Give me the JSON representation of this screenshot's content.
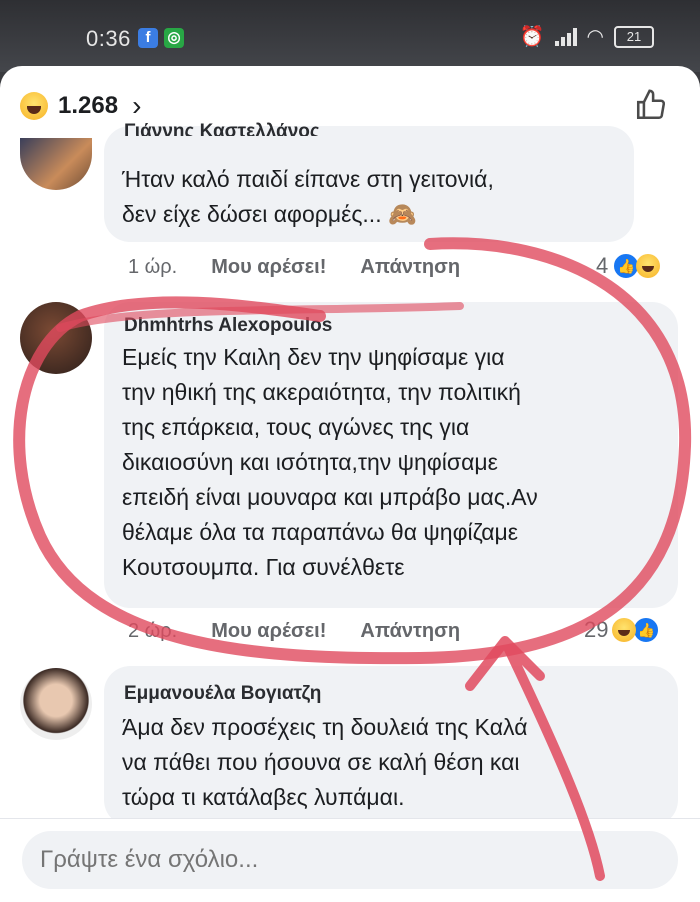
{
  "statusbar": {
    "time": "0:36",
    "battery": "21"
  },
  "header": {
    "reaction_count": "1.268",
    "chevron": "›"
  },
  "comments": [
    {
      "author": "Γιάννης Καστελλάνος",
      "text_lines": [
        "Ήταν καλό παιδί είπανε στη  γειτονιά,",
        "δεν είχε δώσει αφορμές... 🙈"
      ],
      "time": "1 ώρ.",
      "like_label": "Μου αρέσει!",
      "reply_label": "Απάντηση",
      "reactions_count": "4"
    },
    {
      "author": "Dhmhtrhs Alexopoulos",
      "text_lines": [
        "Εμείς την Καιλη δεν την ψηφίσαμε για",
        "την ηθική της ακεραιότητα, την πολιτική",
        "της     επάρκεια, τους αγώνες της για",
        "δικαιοσύνη και ισότητα,την ψηφίσαμε",
        "επειδή είναι μουναρα και μπράβο μας.Αν",
        "θέλαμε όλα τα παραπάνω θα ψηφίζαμε",
        "Κουτσουμπα. Για συνέλθετε"
      ],
      "time": "2 ώρ.",
      "like_label": "Μου αρέσει!",
      "reply_label": "Απάντηση",
      "reactions_count": "29"
    },
    {
      "author": "Εμμανουέλα Βογιατζη",
      "text_lines": [
        "Άμα δεν προσέχεις τη δουλειά της Καλά",
        "να πάθει που ήσουνα σε καλή θέση και",
        "τώρα τι κατάλαβες λυπάμαι."
      ]
    }
  ],
  "composer": {
    "placeholder": "Γράψτε ένα σχόλιο..."
  },
  "colors": {
    "annotation": "#e04a5e",
    "facebook_blue": "#1877f2",
    "bubble": "#f0f2f5"
  }
}
